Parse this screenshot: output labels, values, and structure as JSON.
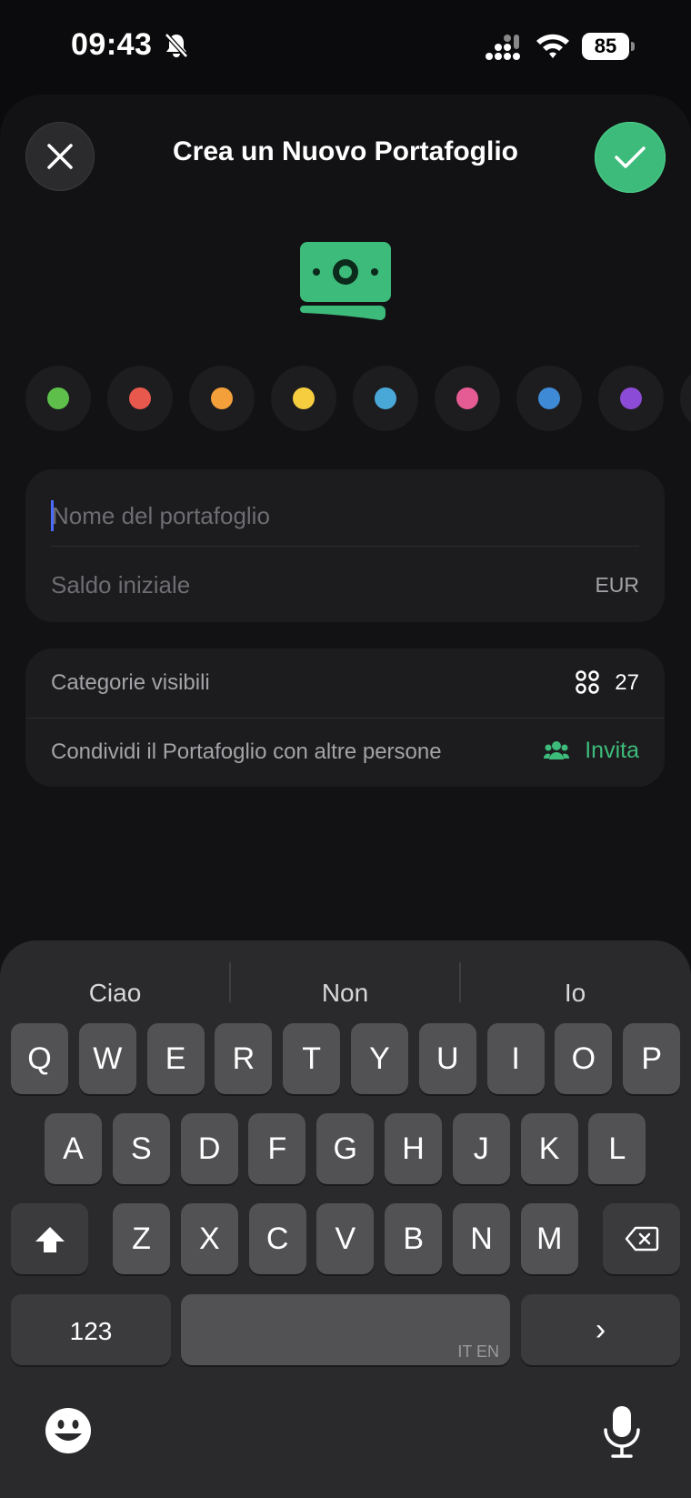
{
  "status": {
    "time": "09:43",
    "battery": "85"
  },
  "header": {
    "title": "Crea un Nuovo Portafoglio"
  },
  "colors": {
    "swatches": [
      "#5ec04a",
      "#e8584d",
      "#f3a03a",
      "#f6cd3f",
      "#4aa8d8",
      "#e45c93",
      "#3e8ad6",
      "#8c4bd6"
    ],
    "icon_color": "#3dbb7a"
  },
  "form": {
    "name_placeholder": "Nome del portafoglio",
    "balance_placeholder": "Saldo iniziale",
    "currency": "EUR"
  },
  "settings": {
    "categories_label": "Categorie visibili",
    "categories_count": "27",
    "share_label": "Condividi il Portafoglio con altre persone",
    "invite_label": "Invita"
  },
  "keyboard": {
    "suggestions": [
      "Ciao",
      "Non",
      "Io"
    ],
    "row1": [
      "Q",
      "W",
      "E",
      "R",
      "T",
      "Y",
      "U",
      "I",
      "O",
      "P"
    ],
    "row2": [
      "A",
      "S",
      "D",
      "F",
      "G",
      "H",
      "J",
      "K",
      "L"
    ],
    "row3": [
      "Z",
      "X",
      "C",
      "V",
      "B",
      "N",
      "M"
    ],
    "numbers_label": "123",
    "space_lang": "IT EN",
    "return_label": "›"
  }
}
